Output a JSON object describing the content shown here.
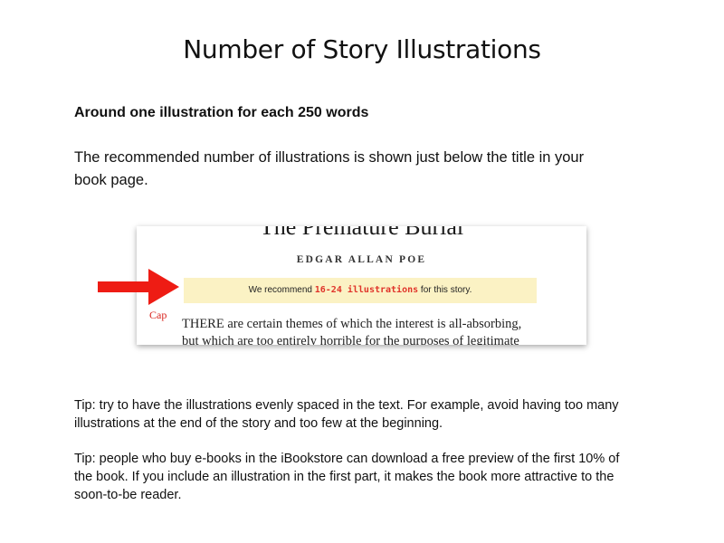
{
  "page": {
    "title": "Number of Story Illustrations",
    "subheading": "Around one illustration for each 250 words",
    "intro": "The recommended number of illustrations is shown just below the title in your book page."
  },
  "figure": {
    "book_title": "The Premature Burial",
    "author": "EDGAR ALLAN POE",
    "recommend_prefix": "We recommend ",
    "recommend_count": "16-24 illustrations",
    "recommend_suffix": " for this story.",
    "cap_label": "Cap",
    "excerpt_line1": "THERE are certain themes of which the interest is all-absorbing,",
    "excerpt_line2": "but which are too entirely horrible for the purposes of legitimate"
  },
  "tips": {
    "tip1": "Tip: try to have the illustrations evenly spaced in the text. For example, avoid having too many illustrations at the end of the story and too few at the beginning.",
    "tip2": "Tip: people who buy e-books in the iBookstore can download a free preview of the first 10% of the book. If you include an illustration in the first part, it makes the book more attractive to the soon-to-be reader."
  },
  "colors": {
    "arrow": "#ee1c14",
    "highlight_bg": "#fbf2c4",
    "highlight_text": "#e0342a"
  },
  "icons": {
    "pointer": "right-arrow-icon"
  }
}
